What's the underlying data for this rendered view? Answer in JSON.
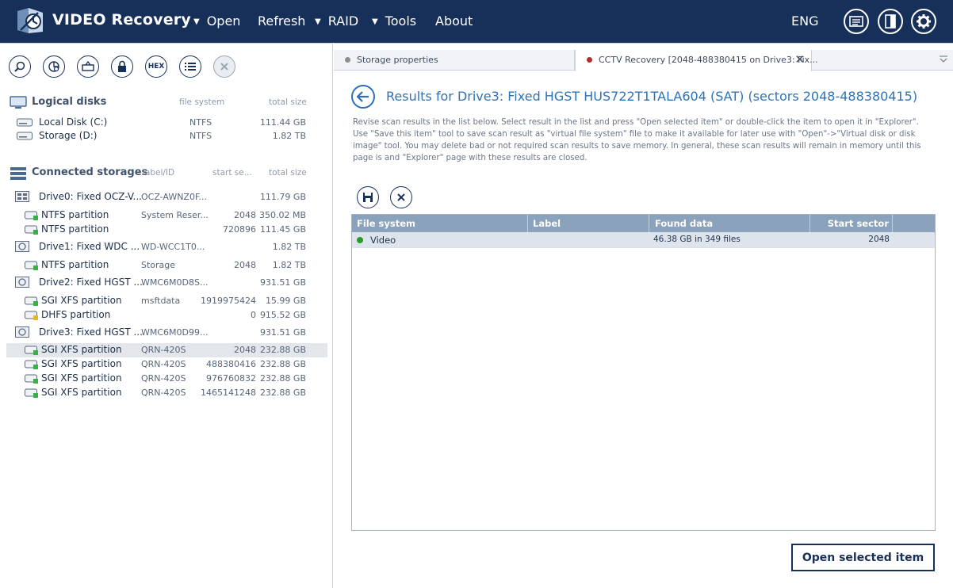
{
  "app": {
    "title": "VIDEO Recovery",
    "menu": [
      "Open",
      "Refresh",
      "RAID",
      "Tools",
      "About"
    ],
    "language": "ENG",
    "colors": {
      "topbar": "#17305a",
      "accent": "#2c73b8",
      "header_row": "#8aa2bb"
    }
  },
  "left": {
    "toolbar": {
      "hex_label": "HEX"
    },
    "logical": {
      "title": "Logical disks",
      "col_fs": "file system",
      "col_size": "total size",
      "items": [
        {
          "name": "Local Disk (C:)",
          "fs": "NTFS",
          "size": "111.44 GB"
        },
        {
          "name": "Storage (D:)",
          "fs": "NTFS",
          "size": "1.82 TB"
        }
      ]
    },
    "storages": {
      "title": "Connected storages",
      "col_label": "label/ID",
      "col_start": "start se...",
      "col_size": "total size",
      "rows": [
        {
          "kind": "drive",
          "name": "Drive0: Fixed OCZ-V...",
          "label": "OCZ-AWNZ0F...",
          "start": "",
          "size": "111.79 GB"
        },
        {
          "kind": "part",
          "name": "NTFS partition",
          "label": "System Reser...",
          "start": "2048",
          "size": "350.02 MB"
        },
        {
          "kind": "part",
          "name": "NTFS partition",
          "label": "",
          "start": "720896",
          "size": "111.45 GB"
        },
        {
          "kind": "drive",
          "name": "Drive1: Fixed WDC ...",
          "label": "WD-WCC1T0...",
          "start": "",
          "size": "1.82 TB"
        },
        {
          "kind": "part",
          "name": "NTFS partition",
          "label": "Storage",
          "start": "2048",
          "size": "1.82 TB"
        },
        {
          "kind": "drive",
          "name": "Drive2: Fixed HGST ...",
          "label": "WMC6M0D8S...",
          "start": "",
          "size": "931.51 GB"
        },
        {
          "kind": "part",
          "name": "SGI XFS partition",
          "label": "msftdata",
          "start": "1919975424",
          "size": "15.99 GB"
        },
        {
          "kind": "part-y",
          "name": "DHFS partition",
          "label": "",
          "start": "0",
          "size": "915.52 GB"
        },
        {
          "kind": "drive",
          "name": "Drive3: Fixed HGST ...",
          "label": "WMC6M0D99...",
          "start": "",
          "size": "931.51 GB"
        },
        {
          "kind": "part",
          "name": "SGI XFS partition",
          "label": "QRN-420S",
          "start": "2048",
          "size": "232.88 GB",
          "selected": true
        },
        {
          "kind": "part",
          "name": "SGI XFS partition",
          "label": "QRN-420S",
          "start": "488380416",
          "size": "232.88 GB"
        },
        {
          "kind": "part",
          "name": "SGI XFS partition",
          "label": "QRN-420S",
          "start": "976760832",
          "size": "232.88 GB"
        },
        {
          "kind": "part",
          "name": "SGI XFS partition",
          "label": "QRN-420S",
          "start": "1465141248",
          "size": "232.88 GB"
        }
      ]
    }
  },
  "right": {
    "tabs": [
      {
        "label": "Storage properties",
        "dot": "#8d8d8d"
      },
      {
        "label": "CCTV Recovery [2048-488380415 on Drive3: Fix...",
        "dot": "#a8322d"
      }
    ],
    "results_title": "Results for Drive3: Fixed HGST HUS722T1TALA604 (SAT) (sectors 2048-488380415)",
    "description": "Revise scan results in the list below. Select result in the list and press \"Open selected item\" or double-click the item to open it in \"Explorer\". Use \"Save this item\" tool to save scan result as \"virtual file system\" file to make it available for later use with \"Open\"->\"Virtual disk or disk image\" tool. You may delete bad or not required scan results to save memory. In general, these scan results will remain in memory until this page is and \"Explorer\" page with these results are closed.",
    "grid": {
      "headers": {
        "fs": "File system",
        "label": "Label",
        "found": "Found data",
        "start": "Start sector"
      },
      "row": {
        "fs": "Video",
        "label": "",
        "found": "46.38 GB in 349 files",
        "start": "2048",
        "status_color": "#2a9a2a"
      }
    },
    "open_button": "Open selected item"
  }
}
